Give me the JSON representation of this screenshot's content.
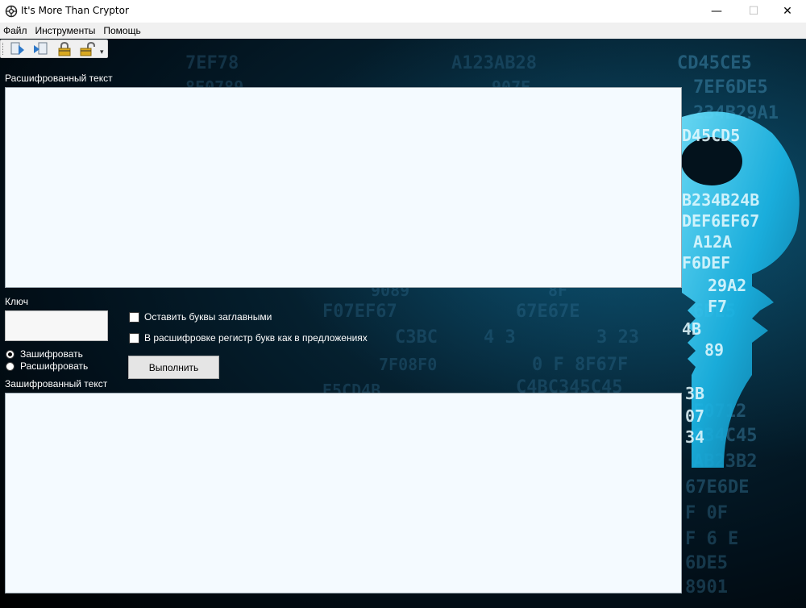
{
  "window": {
    "title": "It's More Than Cryptor",
    "minimize_symbol": "—",
    "maximize_symbol": "☐",
    "close_symbol": "✕"
  },
  "menu": {
    "items": [
      {
        "label": "Файл"
      },
      {
        "label": "Инструменты"
      },
      {
        "label": "Помощь"
      }
    ]
  },
  "toolbar": {
    "buttons": [
      {
        "icon": "open-file-icon"
      },
      {
        "icon": "save-file-icon"
      },
      {
        "icon": "lock-icon"
      },
      {
        "icon": "unlock-icon"
      }
    ],
    "overflow_symbol": "▾"
  },
  "decrypted": {
    "label": "Расшифрованный текст",
    "value": ""
  },
  "key": {
    "label": "Ключ",
    "value": ""
  },
  "mode": {
    "options": [
      {
        "label": "Зашифровать",
        "selected": true
      },
      {
        "label": "Расшифровать",
        "selected": false
      }
    ]
  },
  "options": {
    "keep_capitals": {
      "label": "Оставить буквы заглавными",
      "checked": false
    },
    "sentence_case": {
      "label": "В расшифровке регистр букв как в предложениях",
      "checked": false
    }
  },
  "execute_button": {
    "label": "Выполнить"
  },
  "encrypted": {
    "label": "Зашифрованный текст",
    "value": ""
  },
  "colors": {
    "background_dark": "#02101a",
    "accent_cyan": "#1ec8f0",
    "textarea_bg": "#f4faff"
  }
}
